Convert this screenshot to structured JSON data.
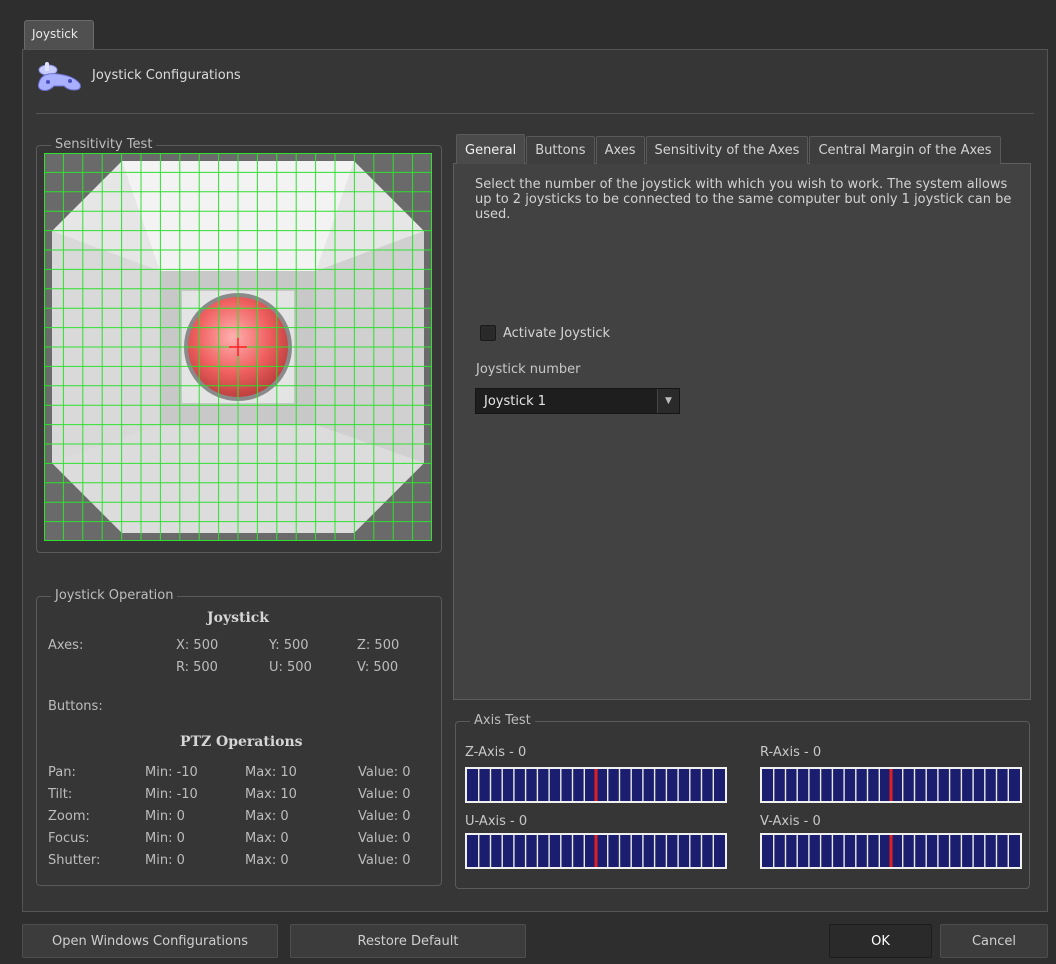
{
  "window_tab": "Joystick",
  "header": {
    "title": "Joystick Configurations",
    "icon": "joystick-icon"
  },
  "sensitivity_test": {
    "title": "Sensitivity Test",
    "grid_color": "#2fe02f",
    "cursor_color": "#ff2020",
    "knob_color": "#f06060"
  },
  "operation": {
    "title": "Joystick Operation",
    "joystick_heading": "Joystick",
    "axes_label": "Axes:",
    "axes_row1": [
      "X: 500",
      "Y: 500",
      "Z: 500"
    ],
    "axes_row2": [
      "R: 500",
      "U: 500",
      "V: 500"
    ],
    "buttons_label": "Buttons:",
    "ptz_heading": "PTZ Operations",
    "ptz_rows": [
      {
        "name": "Pan:",
        "min": "Min: -10",
        "max": "Max: 10",
        "value": "Value: 0"
      },
      {
        "name": "Tilt:",
        "min": "Min: -10",
        "max": "Max: 10",
        "value": "Value: 0"
      },
      {
        "name": "Zoom:",
        "min": "Min: 0",
        "max": "Max: 0",
        "value": "Value: 0"
      },
      {
        "name": "Focus:",
        "min": "Min: 0",
        "max": "Max: 0",
        "value": "Value: 0"
      },
      {
        "name": "Shutter:",
        "min": "Min: 0",
        "max": "Max: 0",
        "value": "Value: 0"
      }
    ]
  },
  "tabs": [
    {
      "label": "General",
      "active": true
    },
    {
      "label": "Buttons",
      "active": false
    },
    {
      "label": "Axes",
      "active": false
    },
    {
      "label": "Sensitivity of the Axes",
      "active": false
    },
    {
      "label": "Central Margin of the Axes",
      "active": false
    }
  ],
  "general": {
    "description": "Select the number of the joystick with which you wish to work. The system allows up to 2 joysticks to be connected to the same computer but only 1 joystick can be used.",
    "activate_label": "Activate Joystick",
    "activate_checked": false,
    "number_label": "Joystick number",
    "number_value": "Joystick 1"
  },
  "axis_test": {
    "title": "Axis Test",
    "axes": [
      {
        "label": "Z-Axis - 0",
        "level": 0.5
      },
      {
        "label": "R-Axis - 0",
        "level": 0.5
      },
      {
        "label": "U-Axis - 0",
        "level": 0.5
      },
      {
        "label": "V-Axis - 0",
        "level": 0.5
      }
    ],
    "bar_color": "#1b1e6e",
    "marker_color": "#e02020"
  },
  "footer": {
    "open_windows": "Open Windows Configurations",
    "restore_default": "Restore Default",
    "ok": "OK",
    "cancel": "Cancel"
  }
}
